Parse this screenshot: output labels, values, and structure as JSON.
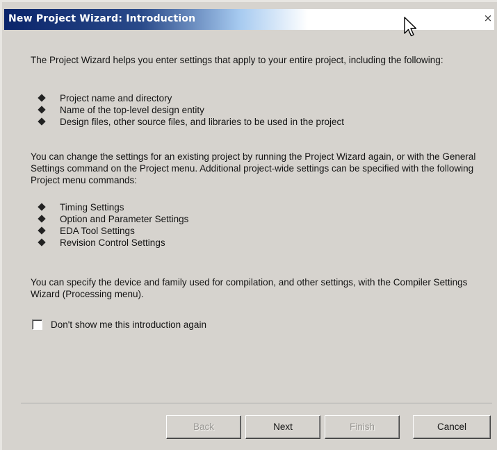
{
  "window": {
    "title": "New Project Wizard: Introduction",
    "close_label": "×"
  },
  "intro": {
    "paragraph1": "The Project Wizard helps you enter settings that apply to your entire project, including the following:",
    "list1": [
      "Project name and directory",
      "Name of the top-level design entity",
      "Design files, other source files, and libraries to be used in the project"
    ],
    "paragraph2": "You can change the settings for an existing project by running the Project Wizard again, or with the General Settings command on the Project menu.  Additional project-wide settings can be specified with the following Project menu commands:",
    "list2": [
      "Timing Settings",
      "Option and Parameter Settings",
      "EDA Tool Settings",
      "Revision Control Settings"
    ],
    "paragraph3": "You can specify the device and family used for compilation, and other settings, with the Compiler Settings Wizard (Processing menu)."
  },
  "checkbox": {
    "label": "Don't show me this introduction again",
    "checked": false
  },
  "buttons": {
    "back": "Back",
    "next": "Next",
    "finish": "Finish",
    "cancel": "Cancel"
  },
  "colors": {
    "title_bar_start": "#0a246a",
    "dialog_face": "#d6d3ce",
    "disabled_text": "#9a9894"
  }
}
